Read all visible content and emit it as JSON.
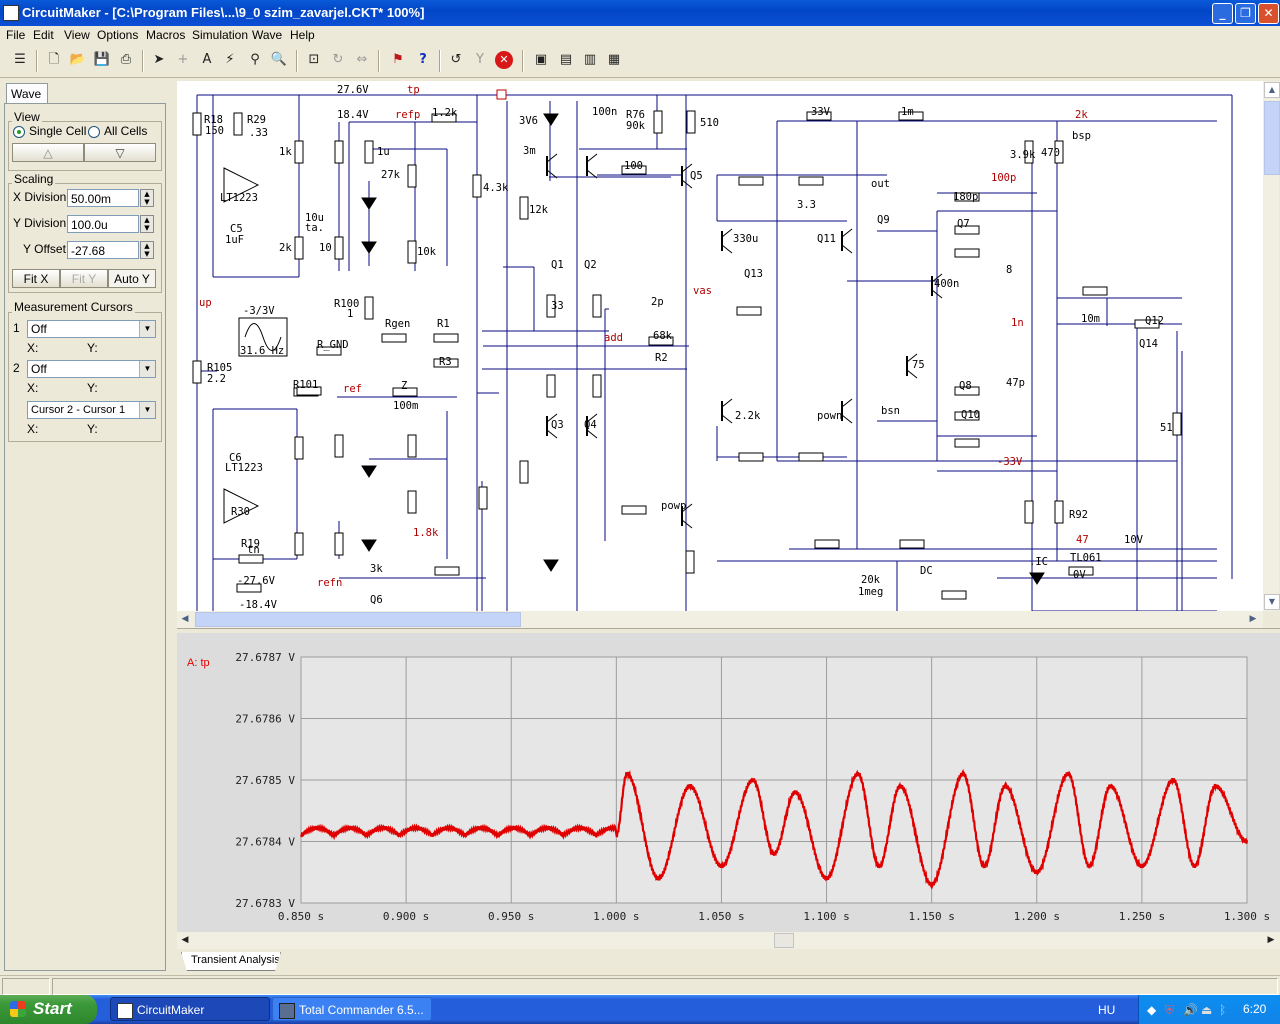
{
  "window": {
    "title": "CircuitMaker - [C:\\Program Files\\...\\9_0 szim_zavarjel.CKT* 100%]"
  },
  "menu": [
    "File",
    "Edit",
    "View",
    "Options",
    "Macros",
    "Simulation",
    "Wave",
    "Help"
  ],
  "left_panel": {
    "tab": "Wave",
    "view_group": "View",
    "single_cell": "Single Cell",
    "all_cells": "All Cells",
    "scaling_group": "Scaling",
    "x_division_label": "X Division",
    "x_division": "50.00m",
    "y_division_label": "Y Division",
    "y_division": "100.0u",
    "y_offset_label": "Y Offset",
    "y_offset": "-27.68",
    "fit_x": "Fit X",
    "fit_y": "Fit Y",
    "auto_y": "Auto Y",
    "cursors_group": "Measurement Cursors",
    "cursor1_num": "1",
    "cursor1_value": "Off",
    "cursor2_num": "2",
    "cursor2_value": "Off",
    "x_label": "X:",
    "y_label": "Y:",
    "cursor_diff": "Cursor 2 - Cursor 1"
  },
  "schematic": {
    "labels": [
      "27.6V",
      "tp",
      "18.4V",
      "refp",
      "1.2k",
      "R18",
      "150",
      "R29",
      ".33",
      "1k",
      "1u",
      "27k",
      "LT1223",
      "C5",
      "1uF",
      "10u",
      "ta.",
      "10",
      "10k",
      "2k",
      "4.3k",
      "3V6",
      "100n",
      "3m",
      "R76",
      "90k",
      "510",
      "100",
      "Q5",
      "12k",
      "Q1",
      "Q2",
      "33",
      "R100",
      "1",
      "up",
      "-3/3V",
      "31.6 Hz",
      "R_GND",
      "Rgen",
      "R1",
      "68k",
      "R2",
      "2p",
      "vas",
      "add",
      "R3",
      "Q3",
      "Q4",
      "R105",
      "2.2",
      "R101",
      "ref",
      "Z",
      "100m",
      "C6",
      "LT1223",
      "R30",
      "R19",
      "tn",
      "-27.6V",
      "-18.4V",
      "refn",
      "Q6",
      "3k",
      "1.8k",
      "powp",
      "33V",
      "1m",
      "2k",
      "bsp",
      "3.9k",
      "470",
      "100p",
      "180p",
      "Q7",
      "Q9",
      "3.3",
      "330u",
      "Q11",
      "Q13",
      "out",
      "400n",
      "8",
      "1n",
      "10m",
      "Q12",
      "Q14",
      "51",
      "75",
      "47p",
      "Q8",
      "Q10",
      "bsn",
      "2.2k",
      "pown",
      "-33V",
      "R92",
      "47",
      "10V",
      "TL061",
      "0V",
      ".IC",
      "DC",
      "20k",
      "1meg"
    ]
  },
  "wave": {
    "trace_label": "A: tp",
    "trace_color": "#e00000",
    "chart_data": {
      "type": "line",
      "title": "",
      "series": [
        {
          "name": "A: tp",
          "sample_x": [
            0.85,
            0.875,
            0.9,
            0.925,
            0.95,
            0.975,
            1.0,
            1.005,
            1.02,
            1.035,
            1.05,
            1.065,
            1.075,
            1.085,
            1.1,
            1.115,
            1.125,
            1.135,
            1.15,
            1.165,
            1.175,
            1.185,
            1.2,
            1.215,
            1.225,
            1.235,
            1.25,
            1.265,
            1.275,
            1.285,
            1.3
          ],
          "sample_y": [
            27.67841,
            27.67842,
            27.67841,
            27.67842,
            27.67841,
            27.67842,
            27.67841,
            27.67851,
            27.67834,
            27.67849,
            27.67836,
            27.6785,
            27.67838,
            27.67848,
            27.67834,
            27.67851,
            27.67836,
            27.67849,
            27.67833,
            27.67851,
            27.67836,
            27.67849,
            27.67835,
            27.67851,
            27.67836,
            27.67849,
            27.67836,
            27.6785,
            27.67836,
            27.67849,
            27.6784
          ]
        }
      ],
      "xlabel": "",
      "ylabel": "",
      "x_ticks": [
        "0.850 s",
        "0.900 s",
        "0.950 s",
        "1.000 s",
        "1.050 s",
        "1.100 s",
        "1.150 s",
        "1.200 s",
        "1.250 s",
        "1.300 s"
      ],
      "y_ticks": [
        "27.6787 V",
        "27.6786 V",
        "27.6785 V",
        "27.6784 V",
        "27.6783 V"
      ],
      "xlim": [
        0.85,
        1.3
      ],
      "ylim": [
        27.6783,
        27.6787
      ],
      "grid": true
    },
    "tab": "Transient Analysis"
  },
  "taskbar": {
    "start": "Start",
    "tasks": [
      "CircuitMaker",
      "Total Commander 6.5..."
    ],
    "lang": "HU",
    "clock": "6:20"
  }
}
